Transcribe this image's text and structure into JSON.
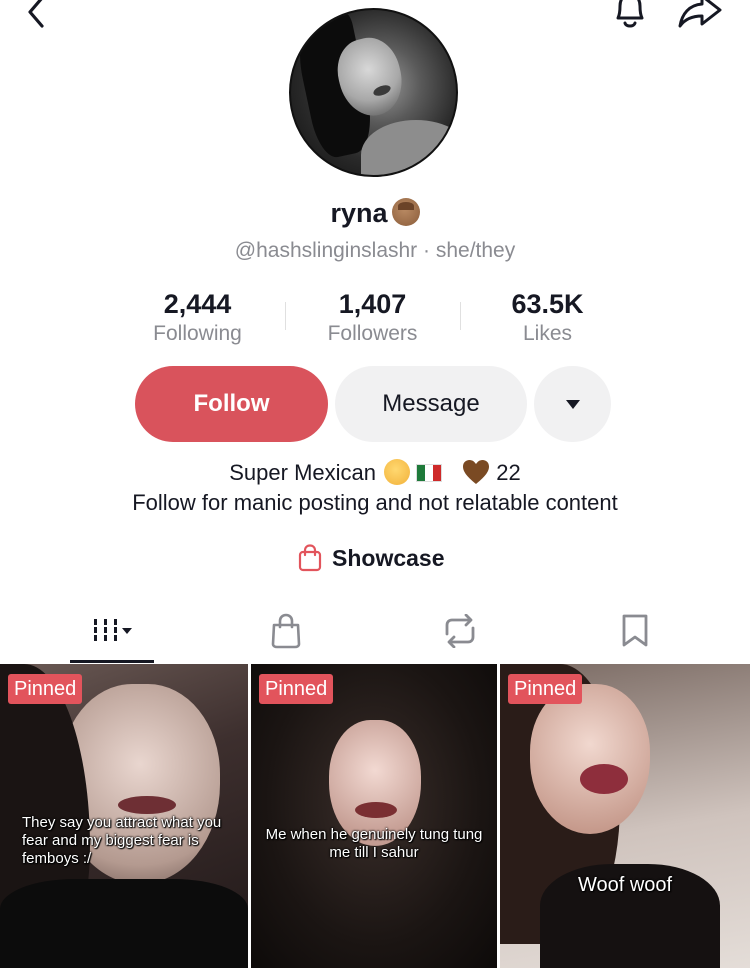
{
  "profile": {
    "display_name": "ryna",
    "handle_line": "@hashslinginslashr · she/they"
  },
  "stats": [
    {
      "value": "2,444",
      "label": "Following"
    },
    {
      "value": "1,407",
      "label": "Followers"
    },
    {
      "value": "63.5K",
      "label": "Likes"
    }
  ],
  "actions": {
    "follow_label": "Follow",
    "message_label": "Message"
  },
  "bio": {
    "line1_text": "Super Mexican",
    "line1_tail": "22",
    "line2": "Follow for manic posting and not relatable content"
  },
  "showcase": {
    "label": "Showcase"
  },
  "videos": [
    {
      "badge": "Pinned",
      "caption": "They say you attract what you fear and my biggest fear is femboys :/"
    },
    {
      "badge": "Pinned",
      "caption": "Me when he genuinely tung tung me till I sahur"
    },
    {
      "badge": "Pinned",
      "caption": "Woof woof"
    }
  ],
  "colors": {
    "follow_button": "#d9535c",
    "pinned_badge": "#e2545c",
    "secondary_text": "#8a8b91"
  }
}
